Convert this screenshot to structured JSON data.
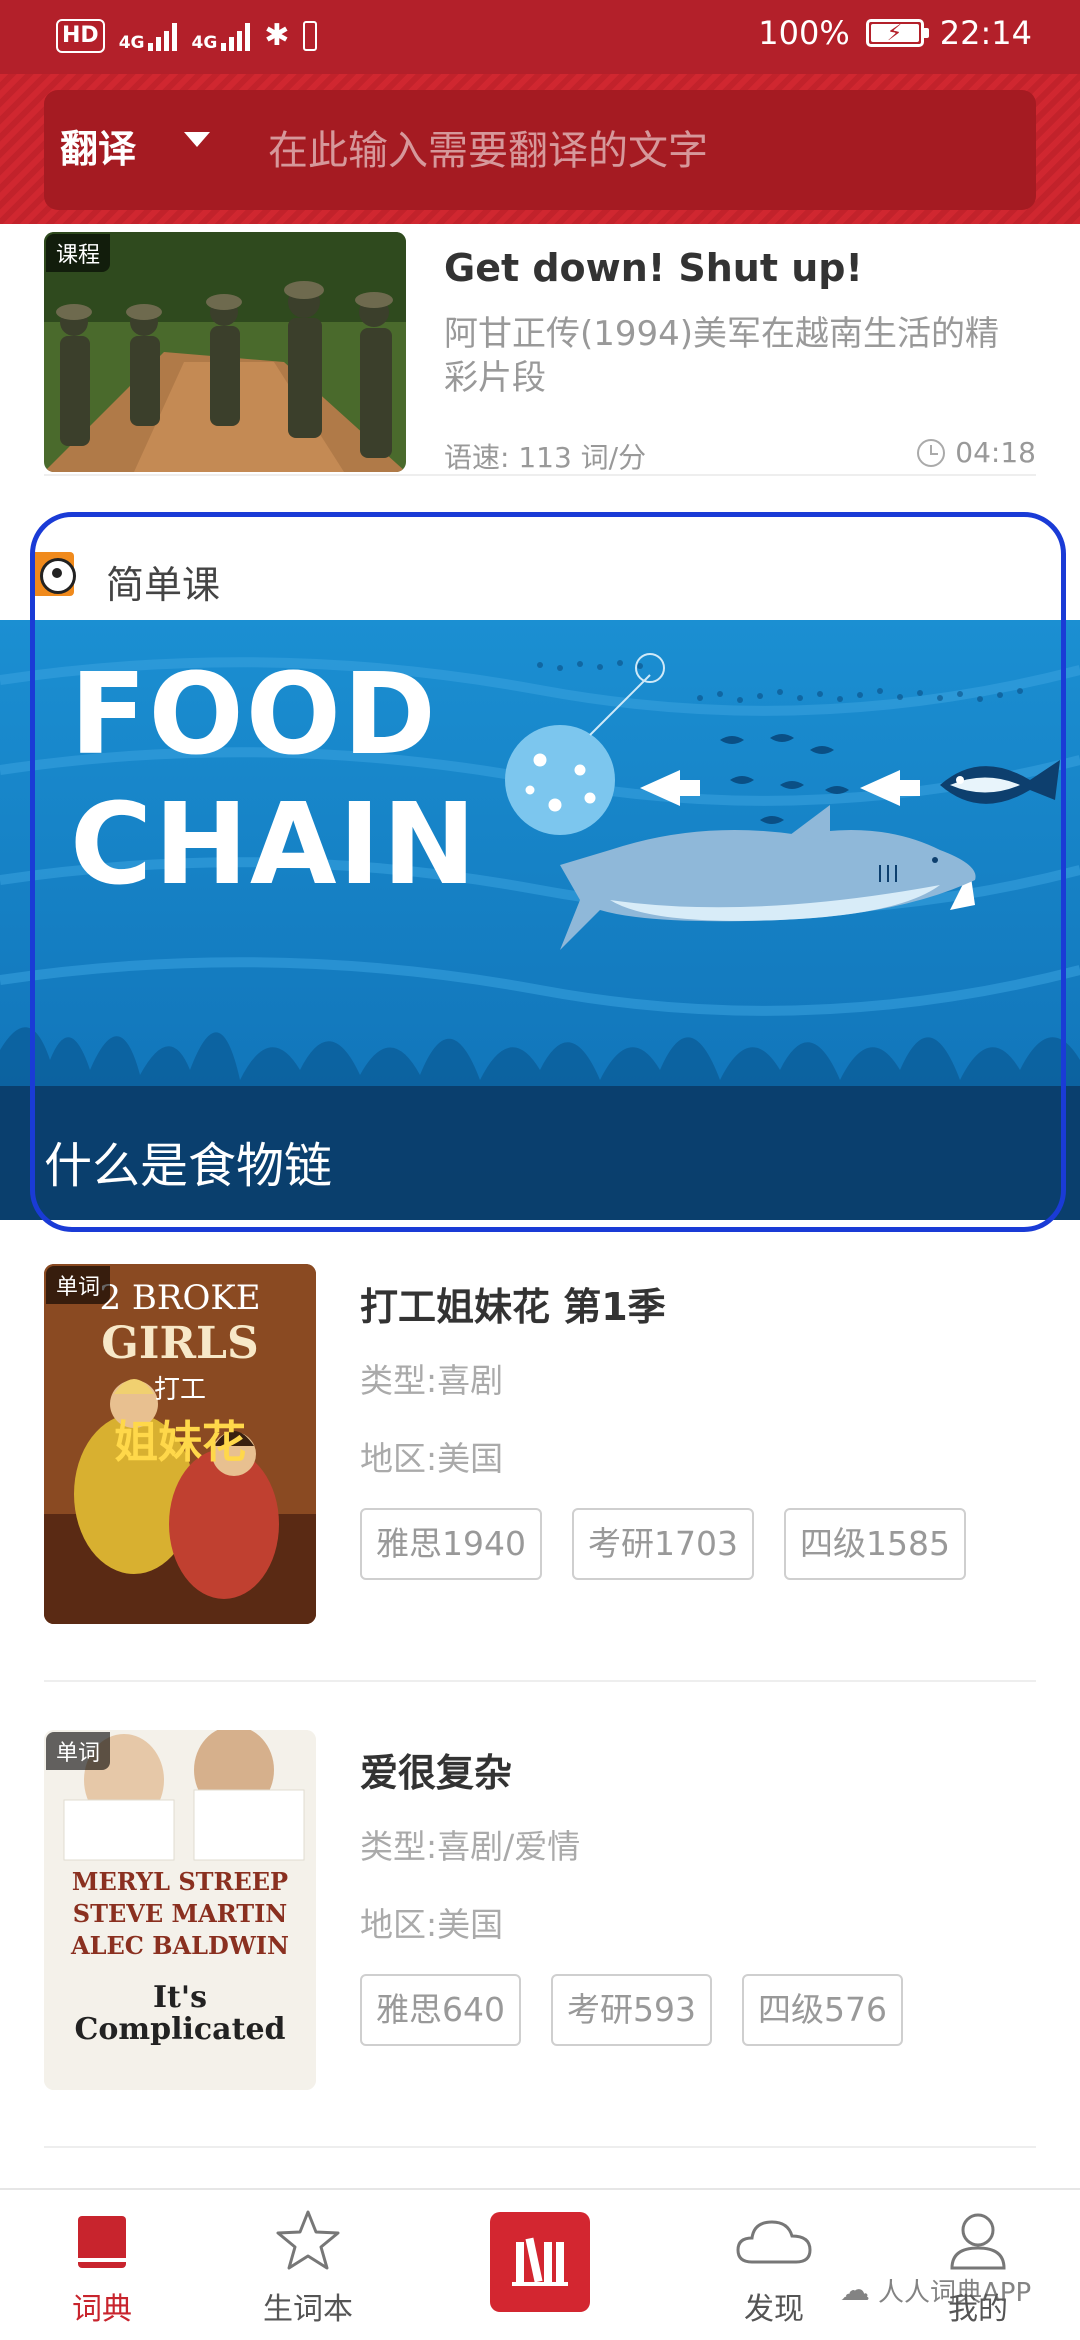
{
  "status_bar": {
    "hd": "HD",
    "net1": "4G",
    "net2": "4G",
    "battery": "100%",
    "time": "22:14"
  },
  "search": {
    "mode": "翻译",
    "placeholder": "在此输入需要翻译的文字"
  },
  "lesson": {
    "tag": "课程",
    "title": "Get down! Shut up!",
    "desc_line1": "阿甘正传(1994)美军在越南生活的精",
    "desc_line2": "彩片段",
    "speed": "语速: 113 词/分",
    "duration": "04:18"
  },
  "featured": {
    "section_title": "简单课",
    "banner_line1": "FOOD",
    "banner_line2": "CHAIN",
    "caption": "什么是食物链"
  },
  "shows": [
    {
      "tag": "单词",
      "poster_line1": "2 BROKE",
      "poster_line2": "GIRLS",
      "poster_line3": "打工",
      "poster_line4": "姐妹花",
      "title": "打工姐妹花 第1季",
      "genre": "类型:喜剧",
      "region": "地区:美国",
      "tags": [
        "雅思1940",
        "考研1703",
        "四级1585"
      ]
    },
    {
      "tag": "单词",
      "poster_line1": "MERYL STREEP",
      "poster_line2": "STEVE MARTIN",
      "poster_line3": "ALEC BALDWIN",
      "poster_line4": "It's Complicated",
      "title": "爱很复杂",
      "genre": "类型:喜剧/爱情",
      "region": "地区:美国",
      "tags": [
        "雅思640",
        "考研593",
        "四级576"
      ]
    }
  ],
  "nav": {
    "items": [
      {
        "label": "词典",
        "icon": "dictionary-icon"
      },
      {
        "label": "生词本",
        "icon": "star-icon"
      },
      {
        "label": "",
        "icon": "library-icon"
      },
      {
        "label": "发现",
        "icon": "cloud-icon"
      },
      {
        "label": "我的",
        "icon": "profile-icon"
      }
    ]
  },
  "watermark": "人人词典APP",
  "colors": {
    "brand_red": "#c8242d",
    "header_red": "#b3202a",
    "banner_blue": "#1d8fd0",
    "highlight_frame": "#1a3bd6"
  }
}
